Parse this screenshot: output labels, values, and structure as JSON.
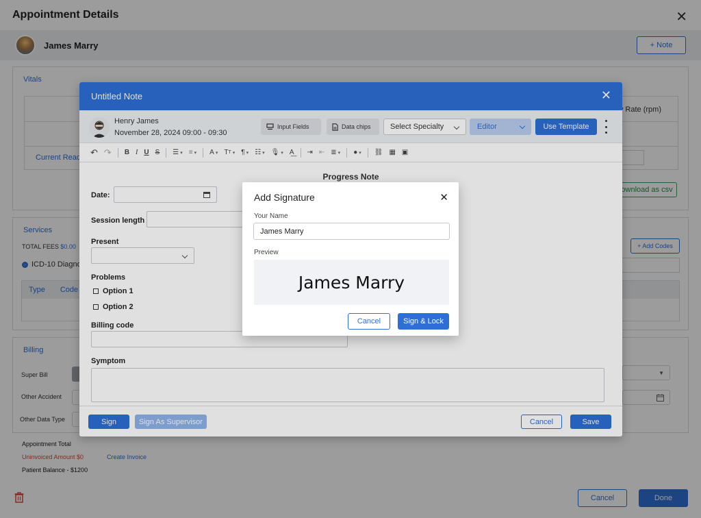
{
  "page": {
    "title": "Appointment Details",
    "patient_name": "James Marry",
    "note_button": "+ Note"
  },
  "vitals": {
    "title": "Vitals",
    "resp_rate_header": "y Rate (rpm)",
    "current_reading": "Current Read",
    "download_csv": "ownload as csv"
  },
  "services": {
    "title": "Services",
    "total_fees_label": "TOTAL FEES",
    "total_fees_value": "$0.00",
    "icd_label": "ICD-10 Diagno",
    "add_codes": "+ Add Codes",
    "col_type": "Type",
    "col_code": "Code"
  },
  "billing": {
    "title": "Billing",
    "super_bill": "Super Bill",
    "other_accident": "Other Accident",
    "other_data_type": "Other Data Type"
  },
  "summary": {
    "appointment_total": "Appointment Total",
    "uninvoiced": "Uninvoiced Amount $0",
    "create_invoice": "Create Invoice",
    "patient_balance": "Patient Balance - $1200"
  },
  "footer": {
    "cancel": "Cancel",
    "done": "Done"
  },
  "note": {
    "title": "Untitled Note",
    "author": "Henry James",
    "datetime": "November 28, 2024  09:00 - 09:30",
    "input_fields": "Input Fields",
    "data_chips": "Data chips",
    "specialty": "Select Specialty",
    "editor": "Editor",
    "use_template": "Use Template",
    "body_title": "Progress Note",
    "date_label": "Date:",
    "session_length_label": "Session length",
    "present_label": "Present",
    "problems_label": "Problems",
    "option1": "Option 1",
    "option2": "Option 2",
    "billing_code_label": "Billing code",
    "symptom_label": "Symptom",
    "sign": "Sign",
    "sign_supervisor": "Sign As Supervisor",
    "cancel": "Cancel",
    "save": "Save"
  },
  "signature": {
    "title": "Add Signature",
    "name_label": "Your Name",
    "name_value": "James Marry",
    "preview_label": "Preview",
    "preview_text": "James Marry",
    "cancel": "Cancel",
    "sign_lock": "Sign & Lock"
  },
  "colors": {
    "accent": "#2e6fd6",
    "danger": "#d9473a",
    "success": "#3aa35b"
  }
}
